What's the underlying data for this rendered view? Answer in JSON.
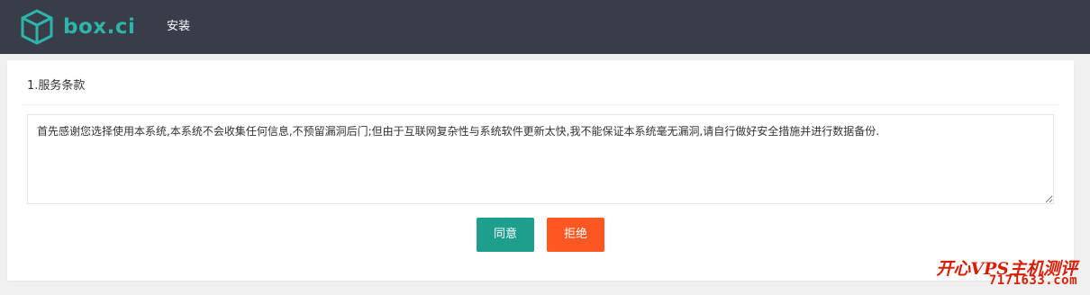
{
  "header": {
    "logo_text": "box.ci",
    "nav": [
      "安装"
    ]
  },
  "card": {
    "title": "1.服务条款",
    "terms_text": "首先感谢您选择使用本系统,本系统不会收集任何信息,不预留漏洞后门;但由于互联网复杂性与系统软件更新太快,我不能保证本系统毫无漏洞,请自行做好安全措施并进行数据备份."
  },
  "buttons": {
    "agree": "同意",
    "reject": "拒绝"
  },
  "watermark": {
    "line1": "开心VPS主机测评",
    "line2": "7171633.com"
  },
  "colors": {
    "topbar": "#393d49",
    "brand": "#2cb5a8",
    "agree": "#1e9e8c",
    "reject": "#ff5722",
    "watermark": "#d81e06"
  },
  "icons": {
    "logo": "cube-icon"
  }
}
